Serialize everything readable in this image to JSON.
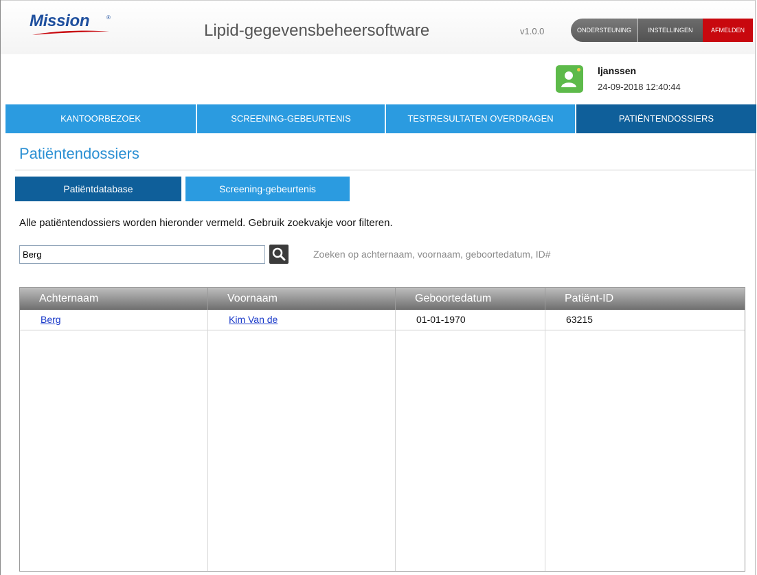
{
  "header": {
    "logo_text": "Mission",
    "logo_reg": "®",
    "app_title": "Lipid-gegevensbeheersoftware",
    "version": "v1.0.0",
    "support_label": "ONDERSTEUNING",
    "settings_label": "INSTELLINGEN",
    "logout_label": "AFMELDEN"
  },
  "user": {
    "name": "ljanssen",
    "datetime": "24-09-2018 12:40:44"
  },
  "nav": {
    "items": [
      {
        "label": "KANTOORBEZOEK"
      },
      {
        "label": "SCREENING-GEBEURTENIS"
      },
      {
        "label": "TESTRESULTATEN OVERDRAGEN"
      },
      {
        "label": "PATIËNTENDOSSIERS"
      }
    ],
    "active": "PATIËNTENDOSSIERS"
  },
  "page": {
    "title": "Patiëntendossiers",
    "subtabs": [
      {
        "label": "Patiëntdatabase"
      },
      {
        "label": "Screening-gebeurtenis"
      }
    ],
    "active_subtab": "Patiëntdatabase",
    "description": "Alle patiëntendossiers worden hieronder vermeld. Gebruik zoekvakje voor filteren."
  },
  "search": {
    "value": "Berg",
    "hint": "Zoeken op achternaam, voornaam, geboortedatum, ID#"
  },
  "table": {
    "headers": [
      "Achternaam",
      "Voornaam",
      "Geboortedatum",
      "Patiënt-ID"
    ],
    "rows": [
      {
        "achternaam": "Berg",
        "voornaam": "Kim Van de",
        "geboortedatum": "01-01-1970",
        "patient_id": "63215"
      }
    ]
  },
  "colors": {
    "nav_blue": "#2b9be0",
    "nav_active": "#0f5f9a",
    "logout_red": "#c8080e",
    "title_blue": "#2a8fd3",
    "link_blue": "#1a3ac9"
  }
}
